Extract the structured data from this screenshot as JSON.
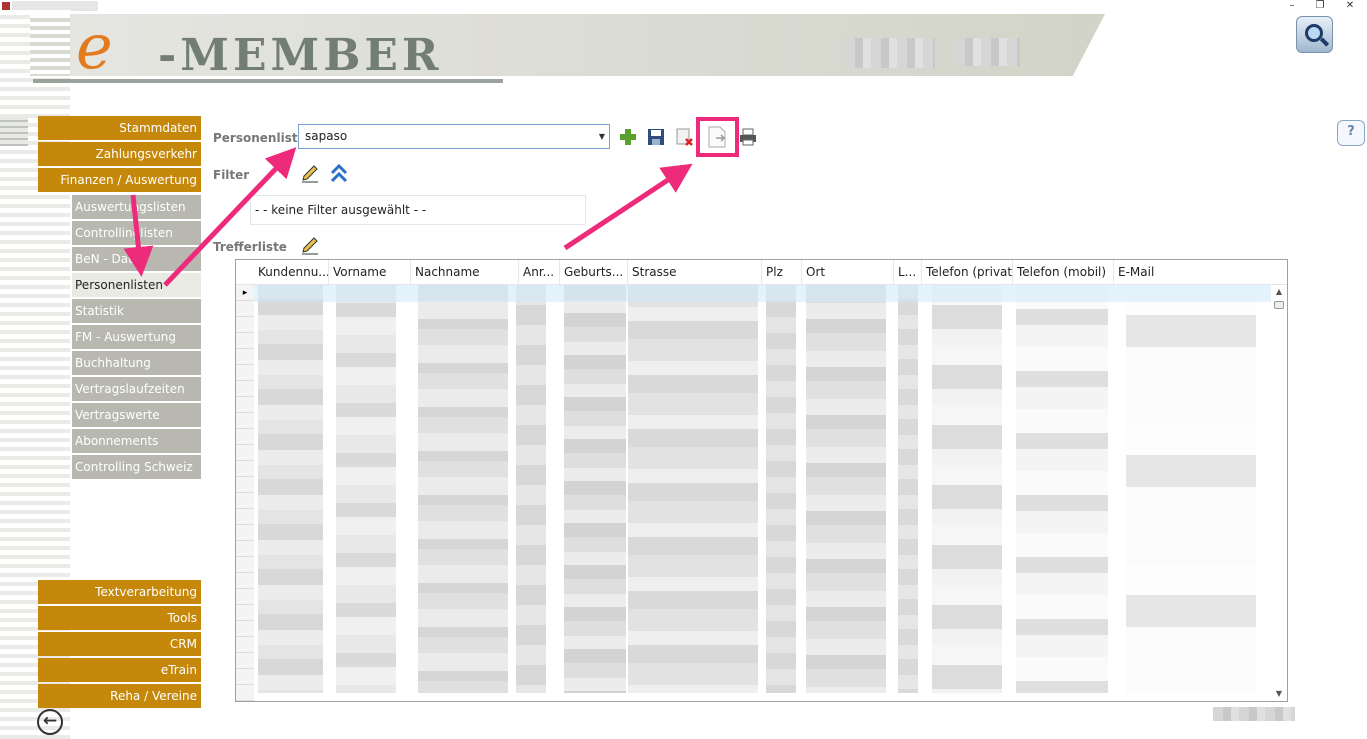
{
  "window": {
    "minimize_icon": "minimize-icon",
    "restore_icon": "restore-icon",
    "close_icon": "close-icon"
  },
  "logo": {
    "e": "e",
    "text": "-MEMBER"
  },
  "colors": {
    "nav_main": "#c6880a",
    "nav_sub": "#b8b8b0",
    "accent_highlight": "#ee2a7b",
    "logo_orange": "#e27a20",
    "logo_grey": "#727d74"
  },
  "sidebar": {
    "main_top": [
      {
        "label": "Stammdaten"
      },
      {
        "label": "Zahlungsverkehr"
      },
      {
        "label": "Finanzen / Auswertung"
      }
    ],
    "sub": [
      {
        "label": "Auswertungslisten"
      },
      {
        "label": "Controllinglisten"
      },
      {
        "label": "BeN - Daten"
      },
      {
        "label": "Personenlisten",
        "active": true
      },
      {
        "label": "Statistik"
      },
      {
        "label": "FM - Auswertung"
      },
      {
        "label": "Buchhaltung"
      },
      {
        "label": "Vertragslaufzeiten"
      },
      {
        "label": "Vertragswerte"
      },
      {
        "label": "Abonnements"
      },
      {
        "label": "Controlling Schweiz"
      }
    ],
    "main_bottom": [
      {
        "label": "Textverarbeitung"
      },
      {
        "label": "Tools"
      },
      {
        "label": "CRM"
      },
      {
        "label": "eTrain"
      },
      {
        "label": "Reha / Vereine"
      }
    ]
  },
  "main": {
    "personenliste_label": "Personenliste",
    "personenliste_value": "sapaso",
    "filter_label": "Filter",
    "filter_text": "- - keine Filter ausgewählt - -",
    "trefferliste_label": "Trefferliste",
    "toolbar": [
      "add-icon",
      "save-icon",
      "delete-icon",
      "export-icon",
      "print-icon"
    ]
  },
  "grid": {
    "columns": [
      "Kundennu...",
      "Vorname",
      "Nachname",
      "Anr...",
      "Geburts...",
      "Strasse",
      "Plz",
      "Ort",
      "L...",
      "Telefon (privat)",
      "Telefon (mobil)",
      "E-Mail"
    ],
    "current_row_marker": "▸"
  },
  "help_icon": "?"
}
